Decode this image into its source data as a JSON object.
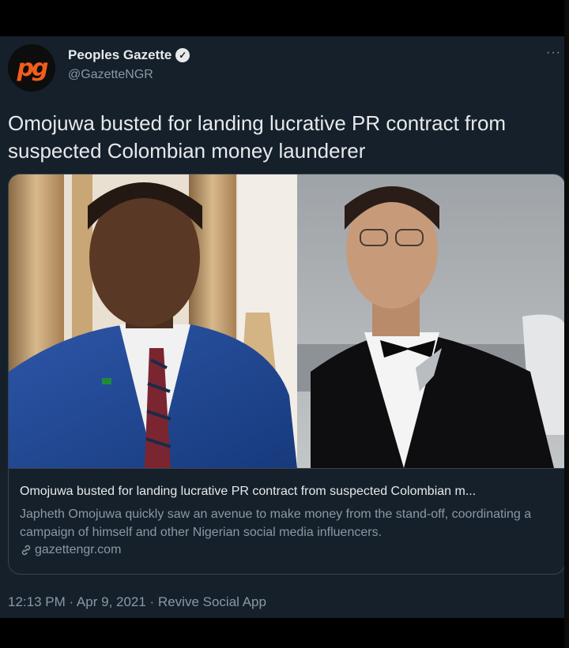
{
  "tweet": {
    "author": {
      "display_name": "Peoples Gazette",
      "handle": "@GazetteNGR",
      "avatar_text": "pg",
      "verified": true
    },
    "more_icon": "more-horizontal-icon",
    "text": "Omojuwa busted for landing lucrative PR contract from suspected Colombian money launderer",
    "link_card": {
      "title": "Omojuwa busted for landing lucrative PR contract from suspected Colombian m...",
      "description": "Japheth Omojuwa quickly saw an avenue to make money from the stand-off, coordinating a campaign of himself and other Nigerian social media influencers.",
      "domain": "gazettengr.com",
      "domain_icon": "link-icon"
    },
    "timestamp": "12:13 PM · Apr 9, 2021 · Revive Social App"
  },
  "colors": {
    "background": "#15202b",
    "border": "#38444d",
    "primary_text": "#e7e9ea",
    "secondary_text": "#8b98a5",
    "brand_orange": "#f25d1b"
  }
}
